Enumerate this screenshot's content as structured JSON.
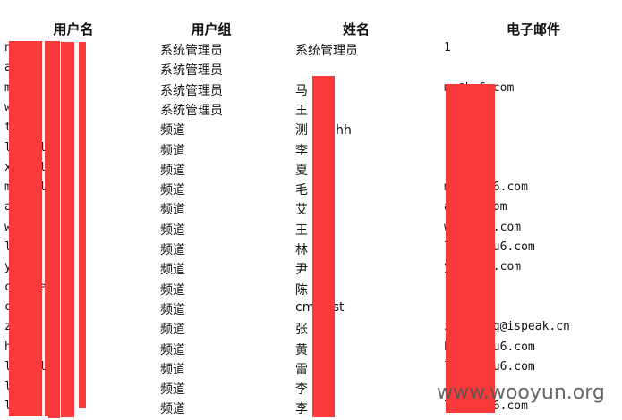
{
  "headers": [
    "用户名",
    "用户组",
    "姓名",
    "电子邮件"
  ],
  "rows": [
    [
      "n",
      "系统管理员",
      "系统管理员",
      "1"
    ],
    [
      "a",
      "系统管理员",
      "",
      ""
    ],
    [
      "m   u",
      "系统管理员",
      "马   军",
      "m       @ku6.com"
    ],
    [
      "w      g  i",
      "系统管理员",
      "王   高",
      ""
    ],
    [
      "t    ()",
      "频道",
      "测   hhhhh",
      ""
    ],
    [
      "l          _del",
      "频道",
      "李   明",
      ""
    ],
    [
      "x        _del",
      "频道",
      "夏   ",
      ""
    ],
    [
      "m         _del",
      "频道",
      "毛   ",
      "m        iu@ku6.com"
    ],
    [
      "a    e",
      "频道",
      "艾   ",
      "a         ku6.com"
    ],
    [
      "w      o",
      "频道",
      "王   ",
      "w        o@ku6.com"
    ],
    [
      "l      g",
      "频道",
      "林   ",
      "l        g01@ku6.com"
    ],
    [
      "y      n",
      "频道",
      "尹   ",
      "y        n@ku6.com"
    ],
    [
      "c          g_del",
      "频道",
      "陈   ",
      ""
    ],
    [
      "c        t",
      "频道",
      "cms  est",
      ""
    ],
    [
      "z        ing",
      "频道",
      "张   ",
      "z        aoting@ispeak.cn"
    ],
    [
      "h        eu",
      "频道",
      "黄   ",
      "h        eng@ku6.com"
    ],
    [
      "l          _del",
      "频道",
      "雷   ",
      "l        hui@ku6.com"
    ],
    [
      "l      l",
      "频道",
      "李   ",
      ""
    ],
    [
      "l         el",
      "频道",
      "李   ",
      "l        un@ku6.com"
    ]
  ],
  "watermark": "www.wooyun.org",
  "redaction_color": "#f93a3a"
}
